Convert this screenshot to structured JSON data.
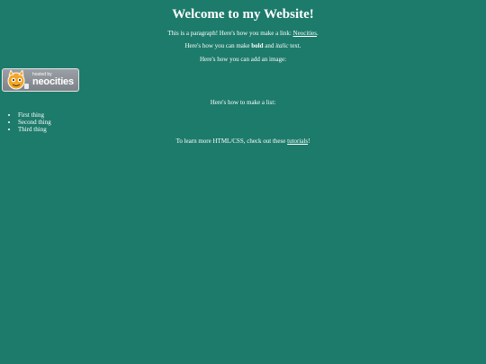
{
  "title": "Welcome to my Website!",
  "para1": {
    "before": "This is a paragraph! Here's how you make a link: ",
    "link": "Neocities",
    "after": "."
  },
  "para2": {
    "before": "Here's how you can make ",
    "bold": "bold",
    "middle": " and ",
    "italic": "italic",
    "after": " text."
  },
  "para3": "Here's how you can add an image:",
  "badge": {
    "small": "hosted by",
    "big": "neocities"
  },
  "para4": "Here's how to make a list:",
  "list": [
    "First thing",
    "Second thing",
    "Third thing"
  ],
  "para5": {
    "before": "To learn more HTML/CSS, check out these ",
    "link": "tutorials",
    "after": "!"
  }
}
